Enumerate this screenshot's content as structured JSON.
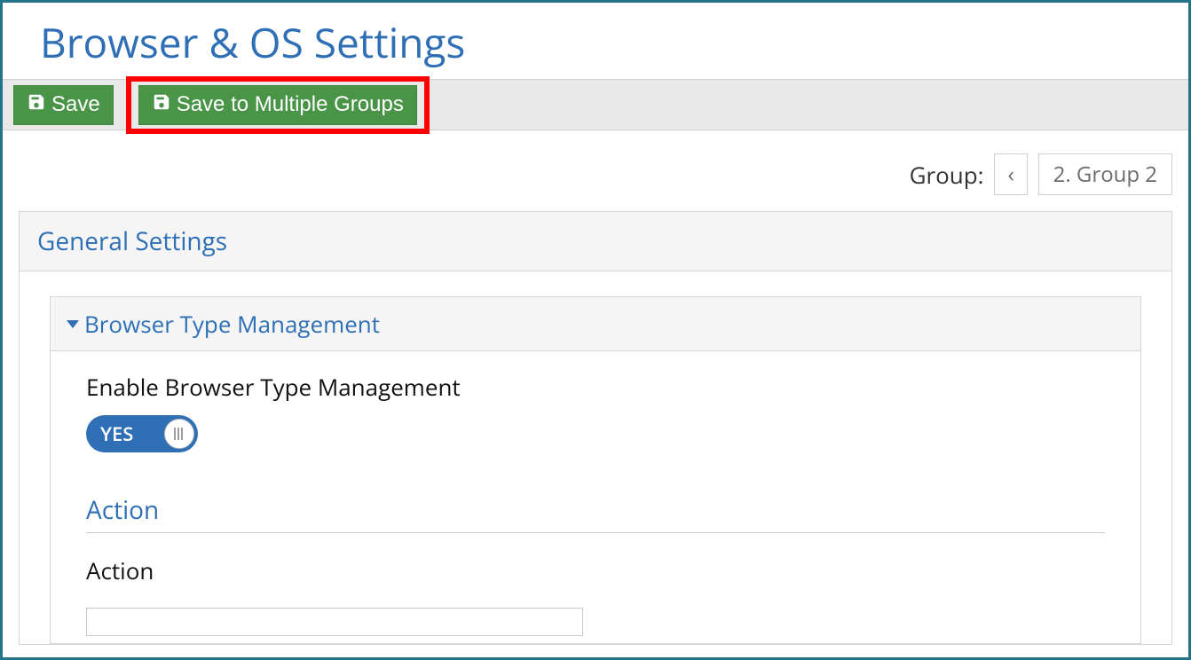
{
  "page": {
    "title": "Browser & OS Settings"
  },
  "toolbar": {
    "save_label": "Save",
    "save_multi_label": "Save to Multiple Groups"
  },
  "group_picker": {
    "label": "Group:",
    "prev_glyph": "‹",
    "selected": "2. Group 2"
  },
  "general": {
    "header": "General Settings",
    "browser_type": {
      "header": "Browser Type Management",
      "enable_label": "Enable Browser Type Management",
      "toggle_value": "YES",
      "action_section_label": "Action",
      "action_field_label": "Action",
      "action_value": ""
    }
  }
}
